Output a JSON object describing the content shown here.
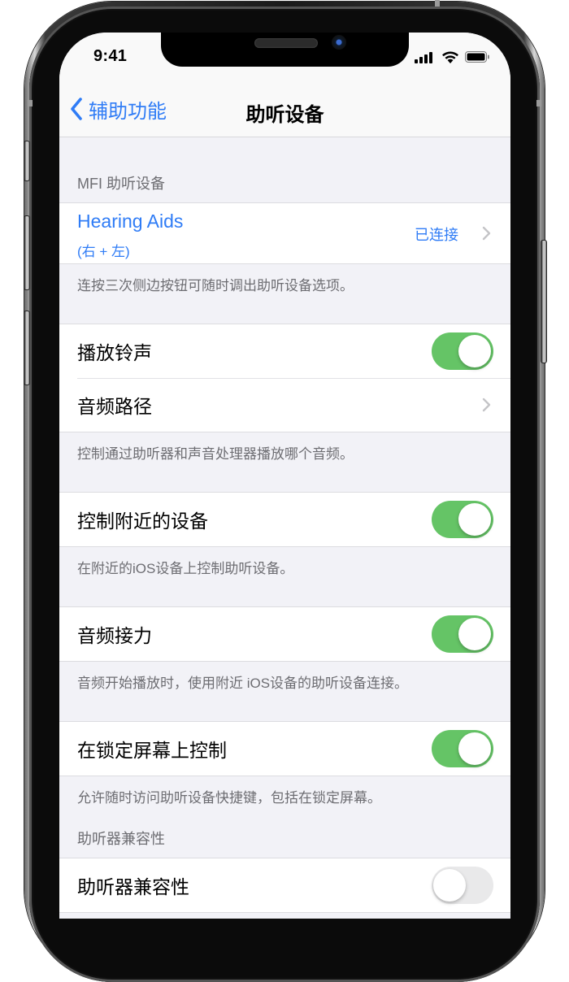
{
  "status_bar": {
    "time": "9:41",
    "icons": [
      "cellular-signal-icon",
      "wifi-icon",
      "battery-icon"
    ]
  },
  "nav": {
    "back_label": "辅助功能",
    "title": "助听设备"
  },
  "sections": {
    "mfi": {
      "header": "MFI 助听设备",
      "device_name": "Hearing Aids",
      "device_sub": "(右 + 左)",
      "status": "已连接",
      "footer": "连按三次侧边按钮可随时调出助听设备选项。"
    },
    "audio": {
      "play_ringtone_label": "播放铃声",
      "play_ringtone_on": true,
      "audio_routing_label": "音频路径",
      "footer": "控制通过助听器和声音处理器播放哪个音频。"
    },
    "nearby": {
      "label": "控制附近的设备",
      "on": true,
      "footer": "在附近的iOS设备上控制助听设备。"
    },
    "handoff": {
      "label": "音频接力",
      "on": true,
      "footer": "音频开始播放时，使用附近 iOS设备的助听设备连接。"
    },
    "lockscreen": {
      "label": "在锁定屏幕上控制",
      "on": true,
      "footer": "允许随时访问助听设备快捷键，包括在锁定屏幕。"
    },
    "hac": {
      "header": "助听器兼容性",
      "label": "助听器兼容性",
      "on": false
    }
  },
  "colors": {
    "accent": "#2f7cf6",
    "toggle_on": "#65c466",
    "toggle_off": "#e9e9ea",
    "group_bg": "#f2f2f7"
  }
}
